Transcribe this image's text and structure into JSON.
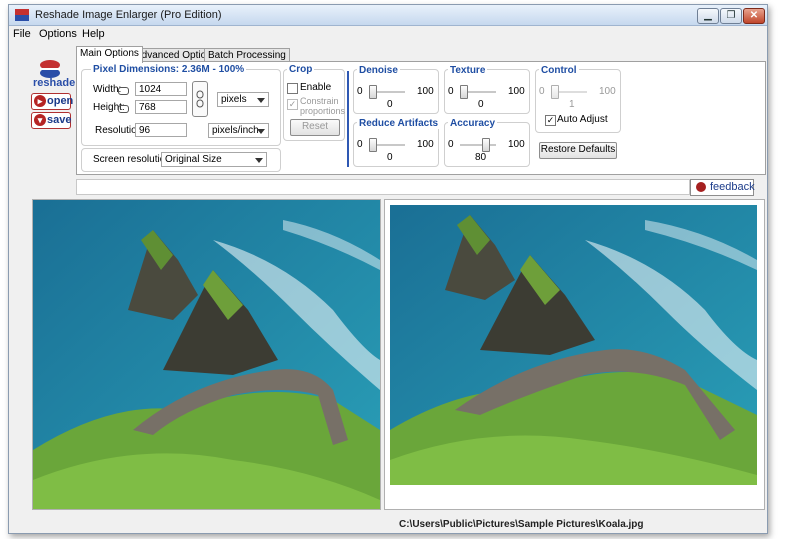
{
  "window": {
    "title": "Reshade Image Enlarger (Pro Edition)"
  },
  "menu": [
    "File",
    "Options",
    "Help"
  ],
  "sidebar": {
    "logo": "reshade",
    "open": "open",
    "save": "save"
  },
  "tabs": [
    "Main Options",
    "Advanced Options",
    "Batch Processing"
  ],
  "pixel_dimensions": {
    "title": "Pixel Dimensions:  2.36M - 100%",
    "width_label": "Width:",
    "width_value": "1024",
    "height_label": "Height:",
    "height_value": "768",
    "unit": "pixels",
    "resolution_label": "Resolution",
    "resolution_value": "96",
    "resolution_unit": "pixels/inch",
    "screen_label": "Screen resolution",
    "screen_value": "Original Size"
  },
  "crop": {
    "title": "Crop",
    "enable": "Enable",
    "constrain": "Constrain proportions",
    "reset": "Reset"
  },
  "sliders": [
    {
      "title": "Denoise",
      "min": "0",
      "max": "100",
      "value": "0",
      "level": 0
    },
    {
      "title": "Texture",
      "min": "0",
      "max": "100",
      "value": "0",
      "level": 0
    },
    {
      "title": "Control",
      "min": "0",
      "max": "100",
      "value": "1",
      "level": 1
    },
    {
      "title": "Reduce Artifacts",
      "min": "0",
      "max": "100",
      "value": "0",
      "level": 0
    },
    {
      "title": "Accuracy",
      "min": "0",
      "max": "100",
      "value": "80",
      "level": 80
    }
  ],
  "control": {
    "auto_adjust": "Auto Adjust",
    "restore": "Restore Defaults"
  },
  "feedback": "feedback",
  "status": {
    "path": "C:\\Users\\Public\\Pictures\\Sample Pictures\\Koala.jpg"
  },
  "colors": {
    "accent": "#1f4ea3",
    "brand_red": "#b52424",
    "sea": "#1c7ea8",
    "grass": "#6aa63a"
  }
}
